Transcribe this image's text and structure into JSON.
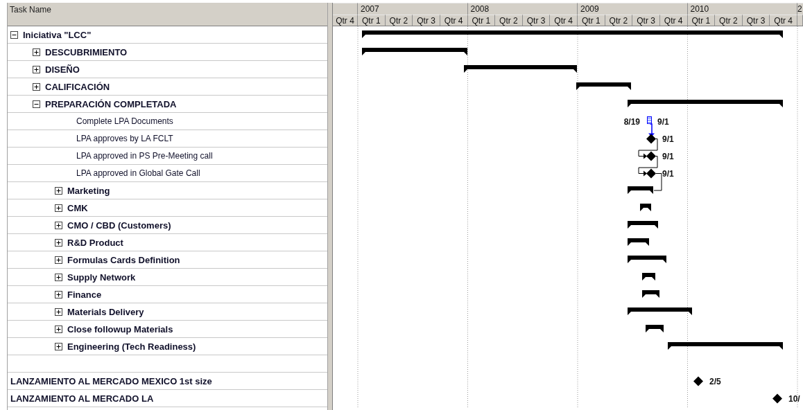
{
  "table": {
    "columns": [
      "Task Name"
    ]
  },
  "timescale": {
    "years": [
      "2007",
      "2008",
      "2009",
      "2010",
      "2"
    ],
    "quarters": [
      "Qtr 4",
      "Qtr 1",
      "Qtr 2",
      "Qtr 3",
      "Qtr 4",
      "Qtr 1",
      "Qtr 2",
      "Qtr 3",
      "Qtr 4",
      "Qtr 1",
      "Qtr 2",
      "Qtr 3",
      "Qtr 4",
      "Qtr 1",
      "Qtr 2",
      "Qtr 3",
      "Qtr 4"
    ]
  },
  "tasks": [
    {
      "name": "Iniciativa \"LCC\"",
      "kind": "summary",
      "expanded": true,
      "children": [
        {
          "name": "DESCUBRIMIENTO",
          "kind": "summary",
          "expanded": false
        },
        {
          "name": "DISEÑO",
          "kind": "summary",
          "expanded": false
        },
        {
          "name": "CALIFICACIÓN",
          "kind": "summary",
          "expanded": false
        },
        {
          "name": "PREPARACIÓN COMPLETADA",
          "kind": "summary",
          "expanded": true,
          "children": [
            {
              "name": "Complete LPA Documents",
              "kind": "task",
              "label_left": "8/19",
              "label_right": "9/1"
            },
            {
              "name": "LPA approves by LA FCLT",
              "kind": "milestone",
              "label_right": "9/1",
              "linked": true
            },
            {
              "name": "LPA approved in PS Pre-Meeting call",
              "kind": "milestone",
              "label_right": "9/1",
              "linked": true
            },
            {
              "name": "LPA approved in Global Gate Call",
              "kind": "milestone",
              "label_right": "9/1",
              "linked": true
            },
            {
              "name": "Marketing",
              "kind": "summary",
              "expanded": false,
              "linked": true
            },
            {
              "name": "CMK",
              "kind": "summary",
              "expanded": false
            },
            {
              "name": "CMO / CBD (Customers)",
              "kind": "summary",
              "expanded": false
            },
            {
              "name": "R&D Product",
              "kind": "summary",
              "expanded": false
            },
            {
              "name": "Formulas Cards Definition",
              "kind": "summary",
              "expanded": false
            },
            {
              "name": "Supply Network",
              "kind": "summary",
              "expanded": false
            },
            {
              "name": "Finance",
              "kind": "summary",
              "expanded": false
            },
            {
              "name": "Materials Delivery",
              "kind": "summary",
              "expanded": false
            },
            {
              "name": "Close followup Materials",
              "kind": "summary",
              "expanded": false
            },
            {
              "name": "Engineering (Tech Readiness)",
              "kind": "summary",
              "expanded": false
            }
          ]
        }
      ]
    },
    {
      "kind": "blank"
    },
    {
      "name": "LANZAMIENTO AL MERCADO MEXICO 1st size",
      "kind": "milestone",
      "label_right": "2/5"
    },
    {
      "name": "LANZAMIENTO AL MERCADO LA",
      "kind": "milestone",
      "label_right": "10/"
    }
  ]
}
